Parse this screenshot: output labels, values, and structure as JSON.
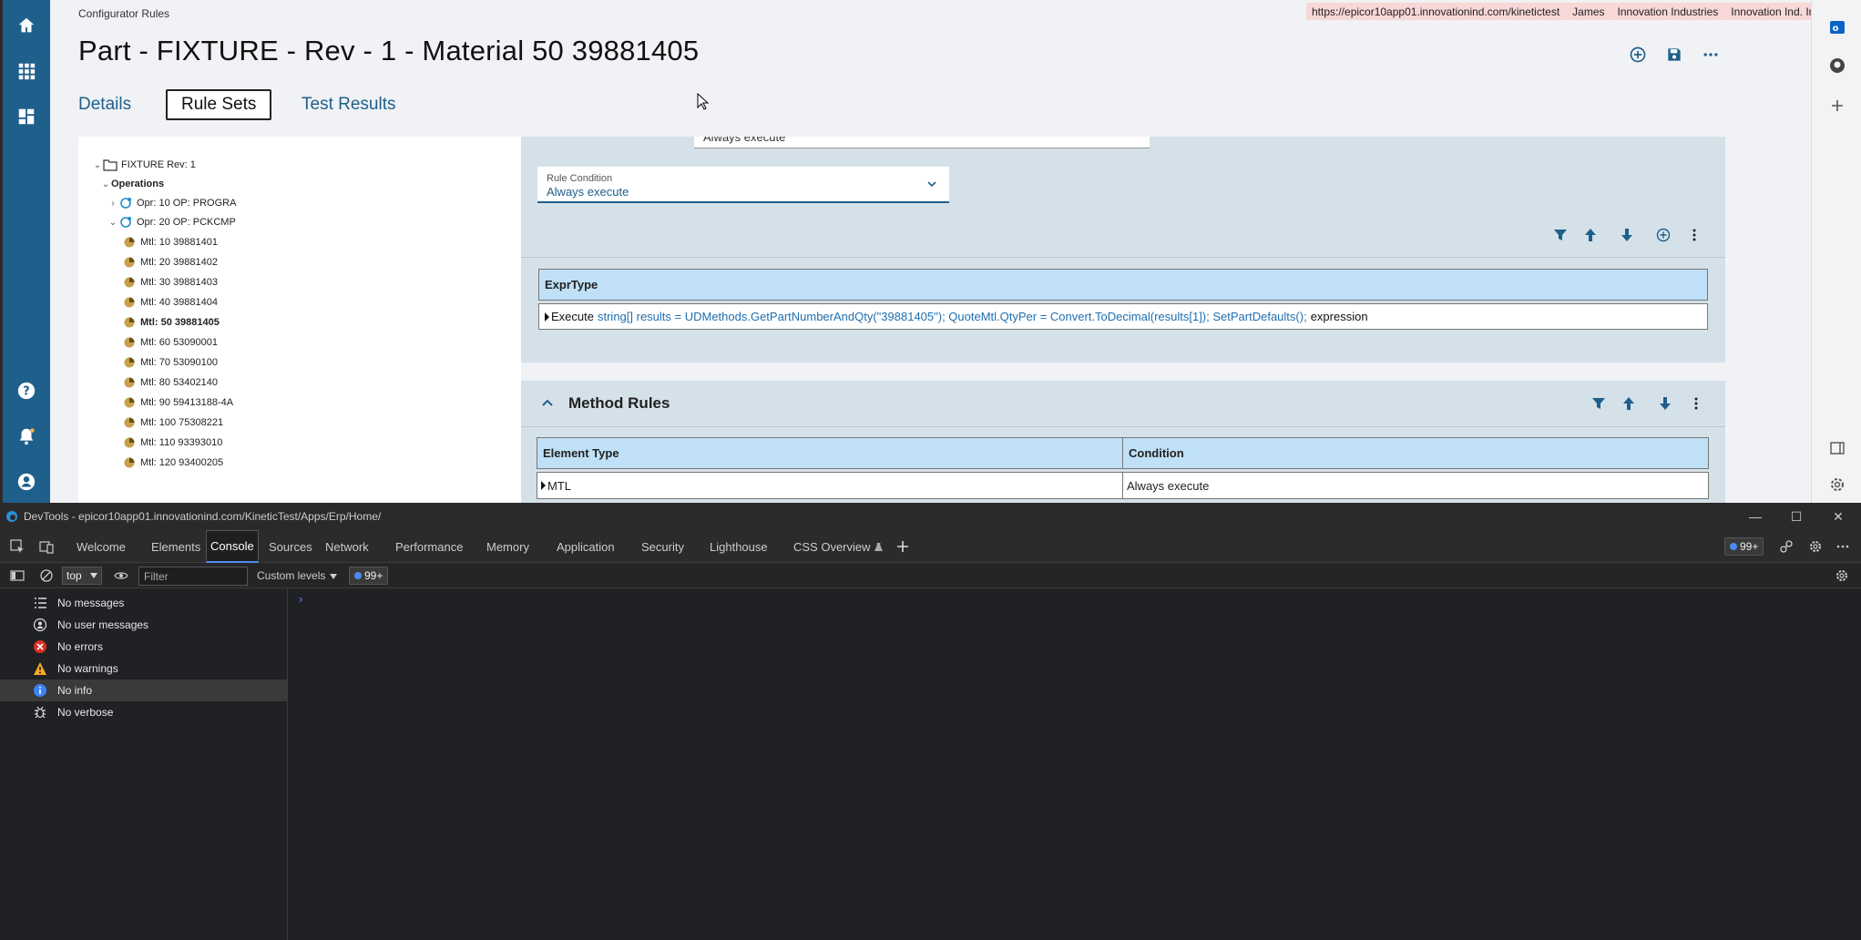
{
  "app": {
    "breadcrumb": "Configurator Rules",
    "topbar": {
      "url": "https://epicor10app01.innovationind.com/kinetictest",
      "user": "James",
      "company": "Innovation Industries",
      "site": "Innovation Ind. Inc."
    },
    "page_title": "Part - FIXTURE - Rev - 1 - Material 50 39881405",
    "tabs": [
      {
        "label": "Details",
        "active": false
      },
      {
        "label": "Rule Sets",
        "active": true
      },
      {
        "label": "Test Results",
        "active": false
      }
    ],
    "tree": {
      "root": "FIXTURE Rev: 1",
      "operations_label": "Operations",
      "operations": [
        {
          "label": "Opr: 10 OP: PROGRA",
          "expanded": false
        },
        {
          "label": "Opr: 20 OP: PCKCMP",
          "expanded": true
        }
      ],
      "materials": [
        {
          "label": "Mtl: 10 39881401",
          "selected": false
        },
        {
          "label": "Mtl: 20 39881402",
          "selected": false
        },
        {
          "label": "Mtl: 30 39881403",
          "selected": false
        },
        {
          "label": "Mtl: 40 39881404",
          "selected": false
        },
        {
          "label": "Mtl: 50 39881405",
          "selected": true
        },
        {
          "label": "Mtl: 60 53090001",
          "selected": false
        },
        {
          "label": "Mtl: 70 53090100",
          "selected": false
        },
        {
          "label": "Mtl: 80 53402140",
          "selected": false
        },
        {
          "label": "Mtl: 90 59413188-4A",
          "selected": false
        },
        {
          "label": "Mtl: 100 75308221",
          "selected": false
        },
        {
          "label": "Mtl: 110 93393010",
          "selected": false
        },
        {
          "label": "Mtl: 120 93400205",
          "selected": false
        }
      ]
    },
    "rule_card": {
      "top_field_value": "Always execute",
      "rule_condition_label": "Rule Condition",
      "rule_condition_value": "Always execute",
      "grid_header": "ExprType",
      "row": {
        "keyword": "Execute",
        "code": "string[] results = UDMethods.GetPartNumberAndQty(\"39881405\"); QuoteMtl.QtyPer = Convert.ToDecimal(results[1]); SetPartDefaults();",
        "tail": "expression"
      }
    },
    "method_rules": {
      "title": "Method Rules",
      "columns": [
        "Element Type",
        "Condition"
      ],
      "rows": [
        {
          "element_type": "MTL",
          "condition": "Always execute"
        }
      ]
    }
  },
  "devtools": {
    "title": "DevTools - epicor10app01.innovationind.com/KineticTest/Apps/Erp/Home/",
    "tabs": [
      {
        "label": "Welcome",
        "active": false
      },
      {
        "label": "Elements",
        "active": false
      },
      {
        "label": "Console",
        "active": true
      },
      {
        "label": "Sources",
        "active": false
      },
      {
        "label": "Network",
        "active": false
      },
      {
        "label": "Performance",
        "active": false
      },
      {
        "label": "Memory",
        "active": false
      },
      {
        "label": "Application",
        "active": false
      },
      {
        "label": "Security",
        "active": false
      },
      {
        "label": "Lighthouse",
        "active": false
      },
      {
        "label": "CSS Overview",
        "active": false
      }
    ],
    "issues_badge": "99+",
    "toolbar": {
      "context": "top",
      "filter_placeholder": "Filter",
      "levels": "Custom levels",
      "badge": "99+"
    },
    "sidebar": [
      {
        "label": "No messages",
        "icon": "list-icon",
        "selected": false
      },
      {
        "label": "No user messages",
        "icon": "user-icon",
        "selected": false
      },
      {
        "label": "No errors",
        "icon": "error-icon",
        "selected": false
      },
      {
        "label": "No warnings",
        "icon": "warning-icon",
        "selected": false
      },
      {
        "label": "No info",
        "icon": "info-icon",
        "selected": true
      },
      {
        "label": "No verbose",
        "icon": "bug-icon",
        "selected": false
      }
    ],
    "prompt": "›"
  },
  "colors": {
    "brand": "#1f5f8b",
    "card": "#d5e1e8",
    "grid_header": "#bfe0f6",
    "devtools_bg": "#202124",
    "accent": "#4c8bf5"
  }
}
